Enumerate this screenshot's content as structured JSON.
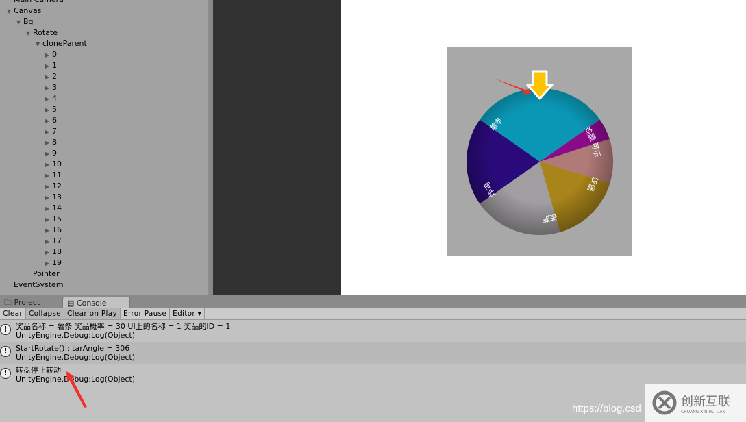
{
  "hierarchy": {
    "items": [
      {
        "label": "Main Camera",
        "depth": 0,
        "arrow": ""
      },
      {
        "label": "Canvas",
        "depth": 0,
        "arrow": "down"
      },
      {
        "label": "Bg",
        "depth": 1,
        "arrow": "down"
      },
      {
        "label": "Rotate",
        "depth": 2,
        "arrow": "down"
      },
      {
        "label": "cloneParent",
        "depth": 3,
        "arrow": "down"
      },
      {
        "label": "0",
        "depth": 4,
        "arrow": "right"
      },
      {
        "label": "1",
        "depth": 4,
        "arrow": "right"
      },
      {
        "label": "2",
        "depth": 4,
        "arrow": "right"
      },
      {
        "label": "3",
        "depth": 4,
        "arrow": "right"
      },
      {
        "label": "4",
        "depth": 4,
        "arrow": "right"
      },
      {
        "label": "5",
        "depth": 4,
        "arrow": "right"
      },
      {
        "label": "6",
        "depth": 4,
        "arrow": "right"
      },
      {
        "label": "7",
        "depth": 4,
        "arrow": "right"
      },
      {
        "label": "8",
        "depth": 4,
        "arrow": "right"
      },
      {
        "label": "9",
        "depth": 4,
        "arrow": "right"
      },
      {
        "label": "10",
        "depth": 4,
        "arrow": "right"
      },
      {
        "label": "11",
        "depth": 4,
        "arrow": "right"
      },
      {
        "label": "12",
        "depth": 4,
        "arrow": "right"
      },
      {
        "label": "13",
        "depth": 4,
        "arrow": "right"
      },
      {
        "label": "14",
        "depth": 4,
        "arrow": "right"
      },
      {
        "label": "15",
        "depth": 4,
        "arrow": "right"
      },
      {
        "label": "16",
        "depth": 4,
        "arrow": "right"
      },
      {
        "label": "17",
        "depth": 4,
        "arrow": "right"
      },
      {
        "label": "18",
        "depth": 4,
        "arrow": "right"
      },
      {
        "label": "19",
        "depth": 4,
        "arrow": "right"
      },
      {
        "label": "Pointer",
        "depth": 2,
        "arrow": ""
      },
      {
        "label": "EventSystem",
        "depth": 0,
        "arrow": ""
      }
    ]
  },
  "wheel": {
    "segments": [
      {
        "label": "薯条",
        "color": "#0a97b5",
        "start": 215,
        "end": 325
      },
      {
        "label": "鸡腿",
        "color": "#8a0a8a",
        "start": 325,
        "end": 342
      },
      {
        "label": "可乐",
        "color": "#b07a78",
        "start": 342,
        "end": 377
      },
      {
        "label": "汉堡",
        "color": "#a8841a",
        "start": 377,
        "end": 434
      },
      {
        "label": "披萨",
        "color": "#a19ea1",
        "start": 434,
        "end": 505
      },
      {
        "label": "炸鸡",
        "color": "#2a0a7a",
        "start": 505,
        "end": 575
      }
    ],
    "pointer_color": "#ffc400"
  },
  "tabs": {
    "project": "Project",
    "console": "Console"
  },
  "toolbar": {
    "clear": "Clear",
    "collapse": "Collapse",
    "clear_on_play": "Clear on Play",
    "error_pause": "Error Pause",
    "editor": "Editor ▾"
  },
  "console": {
    "entries": [
      {
        "line1": "奖品名称 = 薯条  奖品概率 = 30  UI上的名称 = 1  奖品的ID = 1",
        "line2": "UnityEngine.Debug:Log(Object)"
      },
      {
        "line1": "StartRotate() : tarAngle = 306",
        "line2": "UnityEngine.Debug:Log(Object)"
      },
      {
        "line1": "转盘停止转动",
        "line2": "UnityEngine.Debug:Log(Object)"
      }
    ]
  },
  "watermark": {
    "url": "https://blog.csd",
    "brand": "创新互联",
    "brand_sub": "CHUANG XIN HU LIAN"
  }
}
